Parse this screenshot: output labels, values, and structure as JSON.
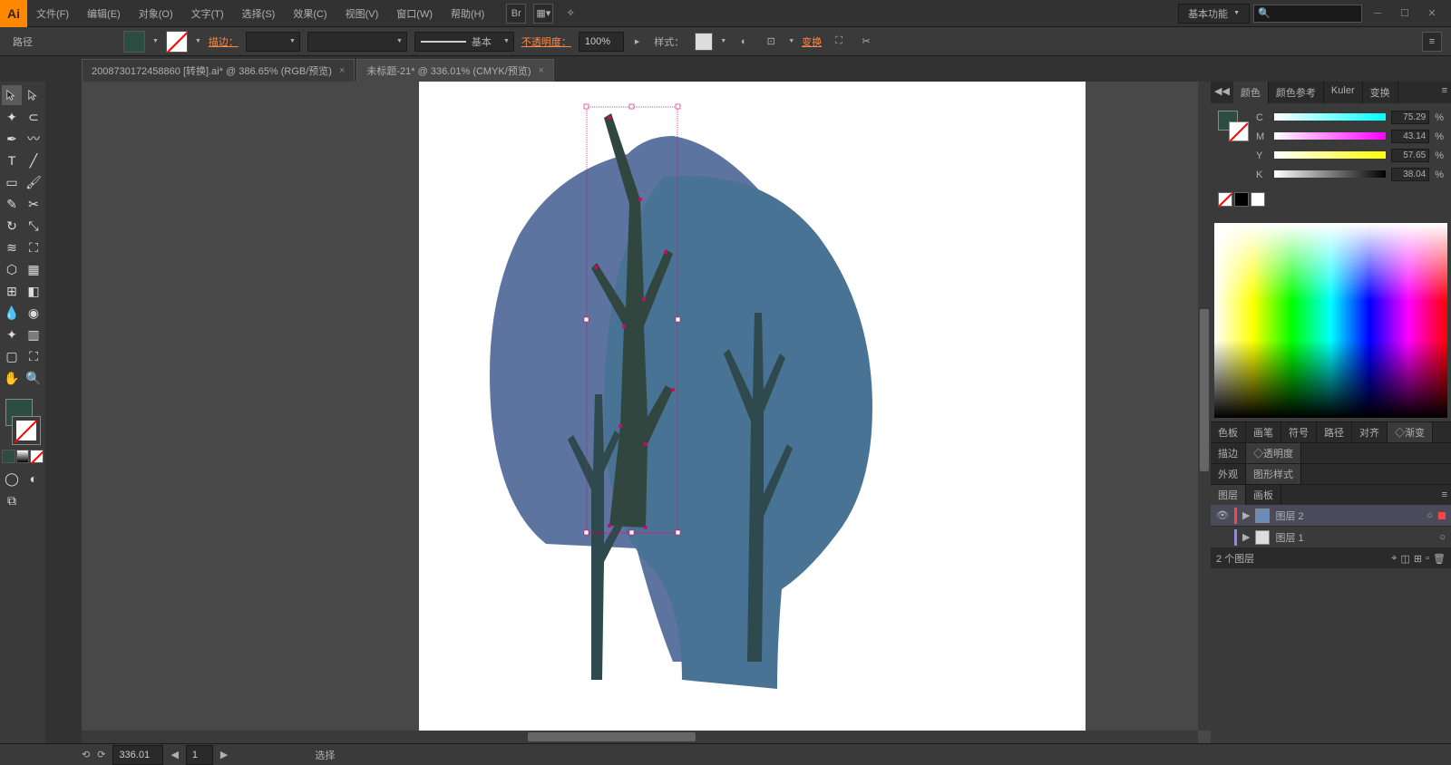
{
  "menubar": {
    "items": [
      "文件(F)",
      "编辑(E)",
      "对象(O)",
      "文字(T)",
      "选择(S)",
      "效果(C)",
      "视图(V)",
      "窗口(W)",
      "帮助(H)"
    ],
    "workspace": "基本功能"
  },
  "control_bar": {
    "selection_label": "路径",
    "stroke_label": "描边：",
    "stroke_style": "基本",
    "opacity_label": "不透明度：",
    "opacity_value": "100%",
    "style_label": "样式：",
    "transform_label": "变换"
  },
  "tabs": [
    {
      "title": "2008730172458860 [转换].ai* @ 386.65% (RGB/预览)",
      "active": false
    },
    {
      "title": "未标题-21* @ 336.01% (CMYK/预览)",
      "active": true
    }
  ],
  "panels": {
    "color": {
      "tabs": [
        "颜色",
        "颜色参考",
        "Kuler",
        "变换"
      ],
      "active_tab": 0,
      "cmyk": {
        "C": "75.29",
        "M": "43.14",
        "Y": "57.65",
        "K": "38.04"
      }
    },
    "tab_row_1": [
      "色板",
      "画笔",
      "符号",
      "路径",
      "对齐",
      "渐变"
    ],
    "tab_row_2": [
      "描边",
      "透明度"
    ],
    "tab_row_3": [
      "外观",
      "图形样式"
    ],
    "layers": {
      "tabs": [
        "图层",
        "画板"
      ],
      "items": [
        {
          "name": "图层 2",
          "selected": true
        },
        {
          "name": "图层 1",
          "selected": false
        }
      ],
      "status": "2 个图层"
    }
  },
  "status_bar": {
    "zoom": "336.01",
    "artboard": "1",
    "tool": "选择"
  }
}
